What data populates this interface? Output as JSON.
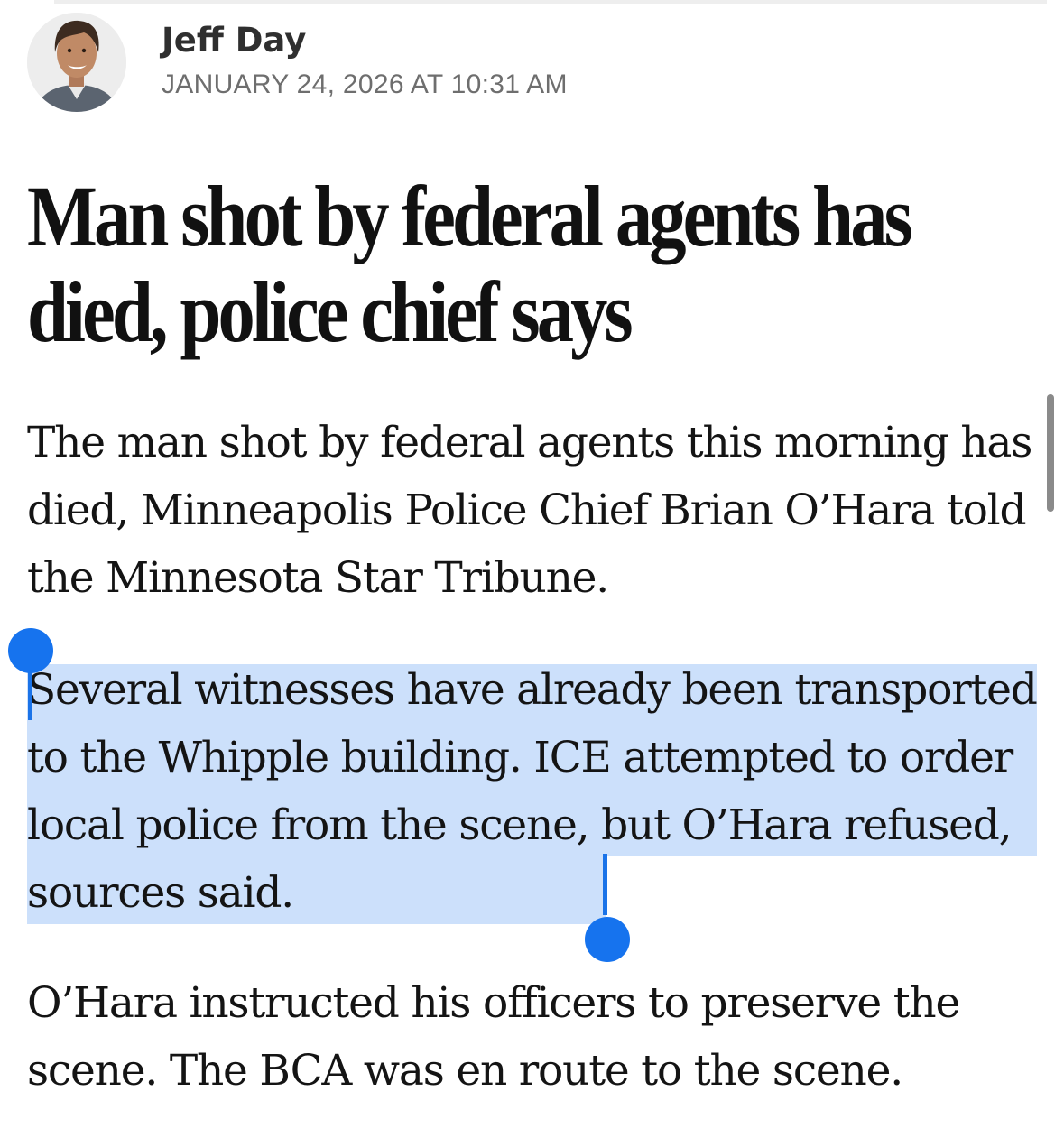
{
  "article": {
    "author": {
      "name": "Jeff Day",
      "timestamp": "JANUARY 24, 2026 AT 10:31 AM"
    },
    "headline": [
      "Man shot by federal agents has",
      "died, police chief says"
    ],
    "paragraphs": [
      "The man shot by federal agents this morning has died, Minneapolis Police Chief Brian O’Hara told the Minnesota Star Tribune.",
      "Several witnesses have already been transported to the Whipple building. ICE attempted to order local police from the scene, but O’Hara refused, sources said.",
      "O’Hara instructed his officers to preserve the scene. The BCA was en route to the scene."
    ]
  },
  "selection": {
    "selected_text": "Several witnesses have already been transported to the Whipple building. ICE attempted to order local police from the scene, but O’Hara refused",
    "color": "#cce0fb",
    "handle_color": "#1673ee"
  }
}
